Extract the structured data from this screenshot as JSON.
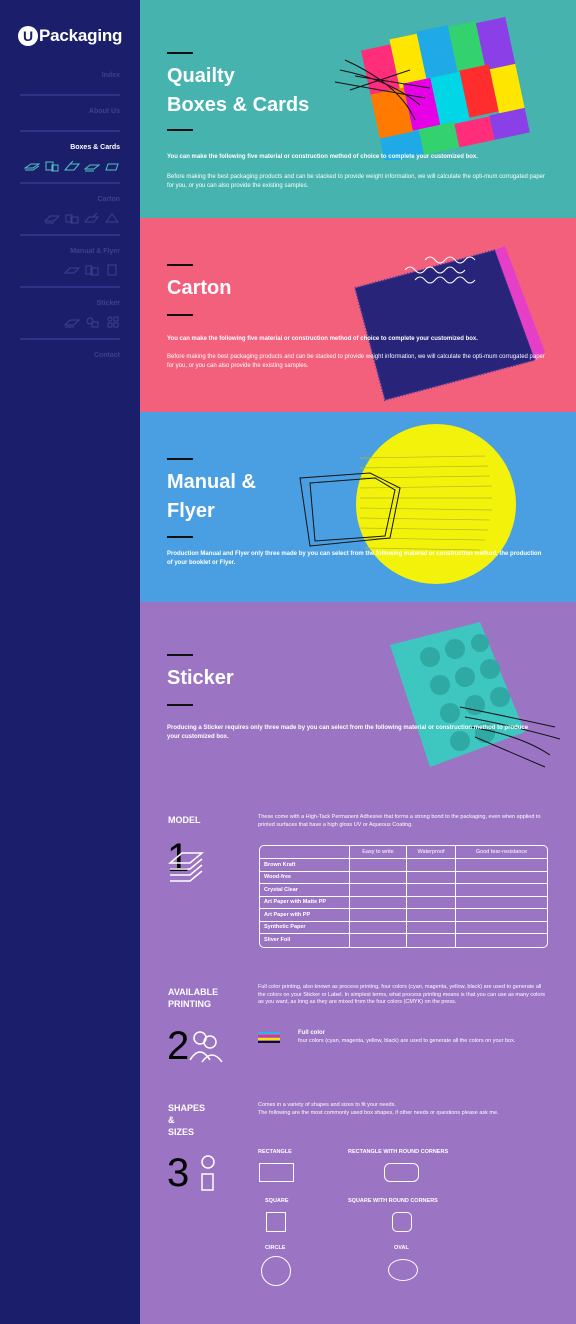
{
  "brand": {
    "logo_letter": "U",
    "name": "Packaging"
  },
  "nav": [
    {
      "label": "Index"
    },
    {
      "label": "About Us"
    },
    {
      "label": "Boxes & Cards"
    },
    {
      "label": "Carton"
    },
    {
      "label": "Manual & Flyer"
    },
    {
      "label": "Sticker"
    },
    {
      "label": "Contact"
    }
  ],
  "boxes": {
    "title_line1": "Quailty",
    "title_line2": "Boxes & Cards",
    "para1": "You can make the following five material or construction method of choice to complete your customized box.",
    "para2": "Before making the best packaging products and can be stacked to provide weight information, we will calculate the opti-mum corrugated paper for you, or you can also provide the existing samples."
  },
  "carton": {
    "title": "Carton",
    "para1": "You can make the following five material or construction method of choice to complete your customized box.",
    "para2": "Before making the best packaging products and can be stacked to provide weight information, we will calculate the opti-mum corrugated paper for you, or you can also provide the existing samples."
  },
  "manual": {
    "title_line1": "Manual &",
    "title_line2": "Flyer",
    "para1": "Production Manual and Flyer only three made by you can select from the following material or construction method, the production of your booklet or Flyer."
  },
  "sticker": {
    "title": "Sticker",
    "para1": "Producing a Sticker requires only three made by you can select from the following material or construction method to produce your customized box.",
    "model": {
      "heading": "MODEL",
      "number": "1",
      "desc": "These come with a High-Tack Permanent Adhesive that forms a strong bond to the packaging, even when applied to printed surfaces that have a high gloss UV or Aqueous Coating.",
      "columns": [
        "",
        "Easy to write",
        "Waterproof",
        "Good tear-resistance"
      ],
      "rows": [
        "Brown Kraft",
        "Wood-free",
        "Crystal Clear",
        "Art Paper with Matte PP",
        "Art Paper with PP",
        "Synthetic Paper",
        "Sliver Foil"
      ]
    },
    "printing": {
      "heading_line1": "AVAILABLE",
      "heading_line2": "PRINTING",
      "number": "2",
      "desc": "Full color printing, also known as process printing, four colors (cyan, magenta, yellow, black) are used to generate all the colors on your Sticker or Label. In simplest terms, what process printing means is that you can use as many colors as you want, as long as they are mixed from the four colors (CMYK) on the press.",
      "option_title": "Full color",
      "option_desc": "four colors (cyan, magenta, yellow, black) are used to generate all the colors on your box.",
      "cmyk_colors": [
        "#29b6e6",
        "#e6338a",
        "#f5e400",
        "#111111"
      ]
    },
    "shapes": {
      "heading_line1": "SHAPES",
      "heading_line2": "&",
      "heading_line3": "SIZES",
      "number": "3",
      "desc_line1": "Comes in a variety of shapes and sizes to fit your needs.",
      "desc_line2": "The following are the most commonly used box shapes, if other needs or questions please ask me.",
      "items": [
        {
          "label": "RECTANGLE"
        },
        {
          "label": "RECTANGLE WITH ROUND CORNERS"
        },
        {
          "label": "SQUARE"
        },
        {
          "label": "SQUARE WITH ROUND CORNERS"
        },
        {
          "label": "CIRCLE"
        },
        {
          "label": "OVAL"
        }
      ]
    }
  }
}
